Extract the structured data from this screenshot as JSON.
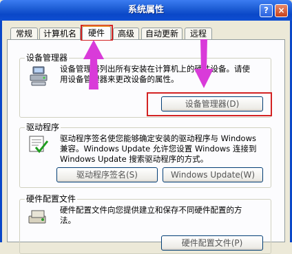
{
  "window": {
    "title": "系统属性",
    "help_label": "?",
    "close_label": "×"
  },
  "tabs": [
    {
      "label": "常规"
    },
    {
      "label": "计算机名"
    },
    {
      "label": "硬件"
    },
    {
      "label": "高级"
    },
    {
      "label": "自动更新"
    },
    {
      "label": "远程"
    }
  ],
  "device_manager": {
    "title": "设备管理器",
    "description_line1": "设备管理器列出所有安装在计算机上的硬件设备。请使",
    "description_line2": "用设备管理器来更改设备的属性。",
    "button_label": "设备管理器(D)"
  },
  "driver": {
    "title": "驱动程序",
    "description_line1": "驱动程序签名使您能够确定安装的驱动程序与 Windows",
    "description_line2": "兼容。Windows Update 允许您设置 Windows 连接到",
    "description_line3": "Windows Update 搜索驱动程序的方式。",
    "signing_button_label": "驱动程序签名(S)",
    "update_button_label": "Windows Update(W)"
  },
  "hardware_profiles": {
    "title": "硬件配置文件",
    "description_line1": "硬件配置文件向您提供建立和保存不同硬件配置的方",
    "description_line2": "法。",
    "button_label": "硬件配置文件(P)"
  },
  "colors": {
    "highlight": "#d32222",
    "arrow": "#d93bd9",
    "titlebar": "#0a47c8"
  }
}
